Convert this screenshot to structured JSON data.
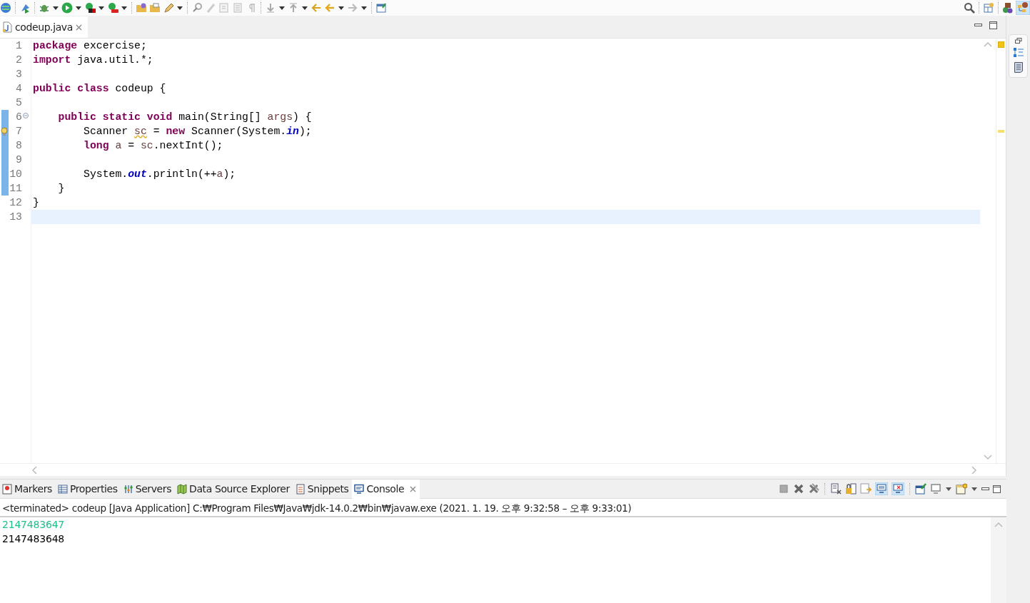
{
  "editor": {
    "tabs": [
      {
        "label": "codeup.java",
        "selected": true
      }
    ],
    "lines": [
      {
        "number": "1",
        "changed": false,
        "warning": false,
        "fold": false,
        "current": false,
        "tokens": [
          {
            "kind": "keyword",
            "text": "package"
          },
          {
            "kind": "plain",
            "text": " excercise;"
          }
        ]
      },
      {
        "number": "2",
        "changed": false,
        "warning": false,
        "fold": false,
        "current": false,
        "tokens": [
          {
            "kind": "keyword",
            "text": "import"
          },
          {
            "kind": "plain",
            "text": " java.util.*;"
          }
        ]
      },
      {
        "number": "3",
        "changed": false,
        "warning": false,
        "fold": false,
        "current": false
      },
      {
        "number": "4",
        "changed": false,
        "warning": false,
        "fold": false,
        "current": false,
        "tokens": [
          {
            "kind": "keyword",
            "text": "public class"
          },
          {
            "kind": "plain",
            "text": " codeup {"
          }
        ]
      },
      {
        "number": "5",
        "changed": false,
        "warning": false,
        "fold": false,
        "current": false
      },
      {
        "number": "6",
        "changed": true,
        "warning": false,
        "fold": true,
        "current": false,
        "tokens": [
          {
            "kind": "keyword",
            "text": "    public static void"
          },
          {
            "kind": "plain",
            "text": " main(String[] "
          },
          {
            "kind": "local",
            "text": "args"
          },
          {
            "kind": "plain",
            "text": ") {"
          }
        ]
      },
      {
        "number": "7",
        "changed": true,
        "warning": true,
        "fold": false,
        "current": false,
        "tokens": [
          {
            "kind": "plain",
            "text": "        Scanner "
          },
          {
            "kind": "warned",
            "text": "sc"
          },
          {
            "kind": "plain",
            "text": " = "
          },
          {
            "kind": "keyword",
            "text": "new"
          },
          {
            "kind": "plain",
            "text": " Scanner(System."
          },
          {
            "kind": "field",
            "text": "in"
          },
          {
            "kind": "plain",
            "text": ");"
          }
        ]
      },
      {
        "number": "8",
        "changed": true,
        "warning": false,
        "fold": false,
        "current": false,
        "tokens": [
          {
            "kind": "keyword",
            "text": "        long "
          },
          {
            "kind": "local",
            "text": "a"
          },
          {
            "kind": "plain",
            "text": " = "
          },
          {
            "kind": "local",
            "text": "sc"
          },
          {
            "kind": "plain",
            "text": ".nextInt();"
          }
        ]
      },
      {
        "number": "9",
        "changed": true,
        "warning": false,
        "fold": false,
        "current": false
      },
      {
        "number": "10",
        "changed": true,
        "warning": false,
        "fold": false,
        "current": false,
        "tokens": [
          {
            "kind": "plain",
            "text": "        System."
          },
          {
            "kind": "field",
            "text": "out"
          },
          {
            "kind": "plain",
            "text": ".println(++"
          },
          {
            "kind": "local",
            "text": "a"
          },
          {
            "kind": "plain",
            "text": ");"
          }
        ]
      },
      {
        "number": "11",
        "changed": true,
        "warning": false,
        "fold": false,
        "current": false,
        "tokens": [
          {
            "kind": "plain",
            "text": "    }"
          }
        ]
      },
      {
        "number": "12",
        "changed": false,
        "warning": false,
        "fold": false,
        "current": false,
        "tokens": [
          {
            "kind": "plain",
            "text": "}"
          }
        ]
      },
      {
        "number": "13",
        "changed": false,
        "warning": false,
        "fold": false,
        "current": true
      }
    ]
  },
  "bottom_panel": {
    "tabs": [
      {
        "label": "Markers",
        "selected": false
      },
      {
        "label": "Properties",
        "selected": false
      },
      {
        "label": "Servers",
        "selected": false
      },
      {
        "label": "Data Source Explorer",
        "selected": false
      },
      {
        "label": "Snippets",
        "selected": false
      },
      {
        "label": "Console",
        "selected": true
      }
    ],
    "console_header": "<terminated> codeup [Java Application] C:₩Program Files₩Java₩jdk-14.0.2₩bin₩javaw.exe  (2021. 1. 19. 오후 9:32:58 – 오후 9:33:01)",
    "output": [
      {
        "kind": "input",
        "text": "2147483647"
      },
      {
        "kind": "output",
        "text": "2147483648"
      }
    ]
  }
}
